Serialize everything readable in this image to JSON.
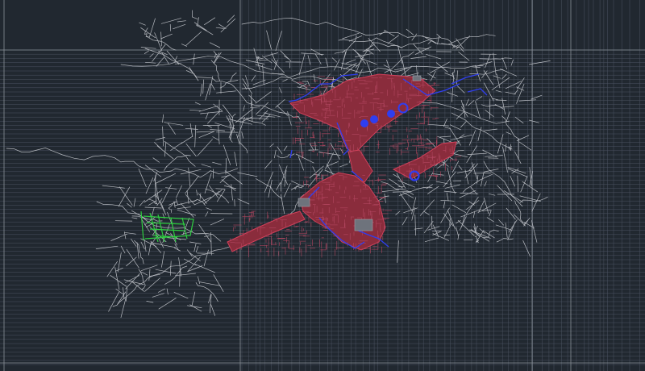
{
  "app": {
    "type": "cad-model-space",
    "description": ""
  },
  "viewport": {
    "background_color": "#212830",
    "grid_color": "#4a5260",
    "frame_color": "#8a9098"
  },
  "layers": [
    {
      "name": "",
      "color": "#b9bcc2",
      "role": "roads"
    },
    {
      "name": "",
      "color": "#c8384a",
      "role": "urban-area"
    },
    {
      "name": "",
      "color": "#2f3ef0",
      "role": "blue-outline"
    },
    {
      "name": "",
      "color": "#2ecc40",
      "role": "green-parcels"
    }
  ],
  "markers": [
    {
      "icon": "circle-marker-icon"
    },
    {
      "icon": "circle-marker-icon"
    },
    {
      "icon": "circle-marker-icon"
    },
    {
      "icon": "circle-marker-icon"
    },
    {
      "icon": "circle-marker-icon"
    }
  ]
}
